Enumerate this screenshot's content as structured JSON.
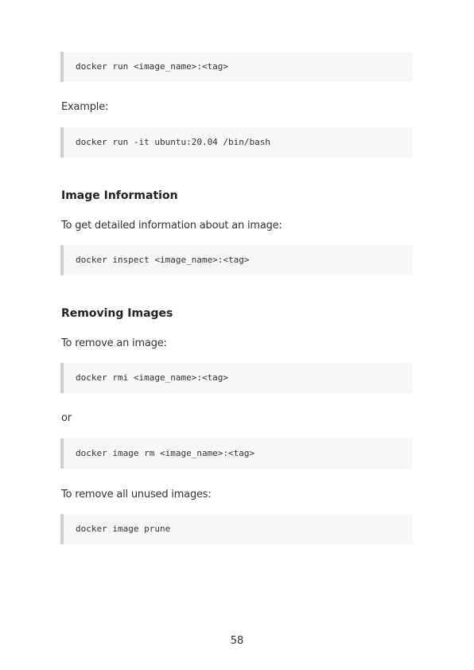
{
  "content": {
    "code_run_tag": "docker run <image_name>:<tag>",
    "example_label": "Example:",
    "code_run_example": "docker run -it ubuntu:20.04 /bin/bash",
    "heading_image_information": "Image Information",
    "inspect_intro": "To get detailed information about an image:",
    "code_inspect": "docker inspect <image_name>:<tag>",
    "heading_removing_images": "Removing Images",
    "remove_intro": "To remove an image:",
    "code_rmi": "docker rmi <image_name>:<tag>",
    "or_label": "or",
    "code_image_rm": "docker image rm <image_name>:<tag>",
    "prune_intro": "To remove all unused images:",
    "code_prune": "docker image prune"
  },
  "footer": {
    "page_number": "58"
  }
}
